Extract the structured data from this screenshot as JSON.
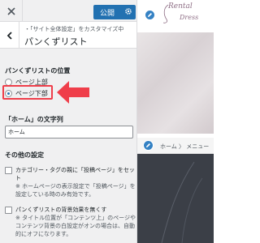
{
  "topbar": {
    "publish_label": "公開"
  },
  "header": {
    "hint": "・「サイト全体設定」をカスタマイズ中",
    "title": "パンくずリスト"
  },
  "position_section": {
    "heading": "パンくずリストの位置",
    "options": [
      {
        "label": "ページ上部",
        "checked": false
      },
      {
        "label": "ページ下部",
        "checked": true
      }
    ]
  },
  "home_section": {
    "heading": "「ホーム」の文字列",
    "value": "ホーム"
  },
  "other_section": {
    "heading": "その他の設定",
    "items": [
      {
        "label": "カテゴリー・タグの親に「投稿ページ」をセット",
        "note": "※ ホームページの表示設定で「投稿ページ」を設定している時のみ有効です。"
      },
      {
        "label": "パンくずリストの背景効果を無くす",
        "note": "※ タイトル位置が「コンテンツ上」のページやコンテンツ背景の白設定がオンの場合は、自動的にオフになります。"
      }
    ]
  },
  "preview": {
    "logo_line1": "Rental",
    "logo_line2": "Dress",
    "breadcrumb": "ホーム 〉 メニュー"
  },
  "colors": {
    "accent": "#2271b1",
    "highlight": "#ef3e4a",
    "pencil": "#3582c4"
  }
}
